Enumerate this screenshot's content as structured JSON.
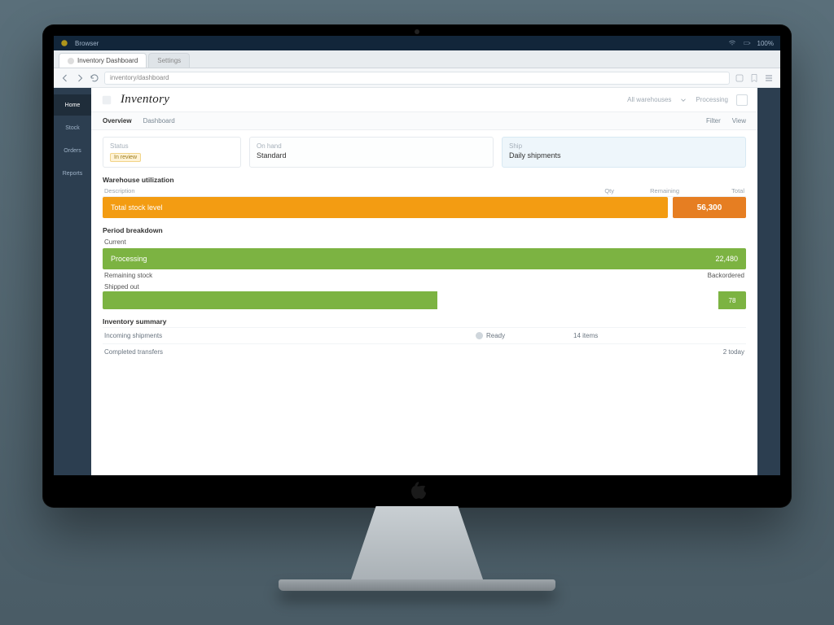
{
  "os": {
    "app_menu": "Browser",
    "right_status": "100%"
  },
  "browser": {
    "tabs": [
      {
        "label": "Inventory Dashboard"
      },
      {
        "label": "Settings"
      }
    ],
    "url": "inventory/dashboard"
  },
  "app": {
    "title": "Inventory",
    "header_meta1": "All warehouses",
    "header_meta2": "Processing",
    "sidebar": {
      "items": [
        {
          "label": "Home"
        },
        {
          "label": "Stock"
        },
        {
          "label": "Orders"
        },
        {
          "label": "Reports"
        }
      ]
    },
    "subnav": {
      "lead": "Overview",
      "crumb": "Dashboard",
      "right1": "Filter",
      "right2": "View"
    },
    "cards": {
      "lead_label": "Status",
      "lead_chip": "In review",
      "c1_label": "On hand",
      "c1_value": "Standard",
      "c2_label": "Ship",
      "c2_value": "Daily shipments"
    },
    "sectionA": {
      "title": "Warehouse utilization",
      "headers": [
        "Description",
        "Qty",
        "Remaining",
        "Total"
      ],
      "orange_label": "Total stock level",
      "orange_value": "56,300"
    },
    "sectionB": {
      "title": "Period breakdown",
      "row1_label": "Current",
      "green_label": "Processing",
      "green_value": "22,480",
      "row2_label": "Remaining stock",
      "row2_value": "Backordered",
      "row3_label": "Shipped out",
      "half_value": "78"
    },
    "sectionC": {
      "title": "Inventory summary",
      "rows": [
        {
          "a": "Incoming shipments",
          "b": "Ready",
          "c": "14 items",
          "d": ""
        },
        {
          "a": "Completed transfers",
          "b": "",
          "c": "",
          "d": "2 today"
        }
      ]
    }
  }
}
